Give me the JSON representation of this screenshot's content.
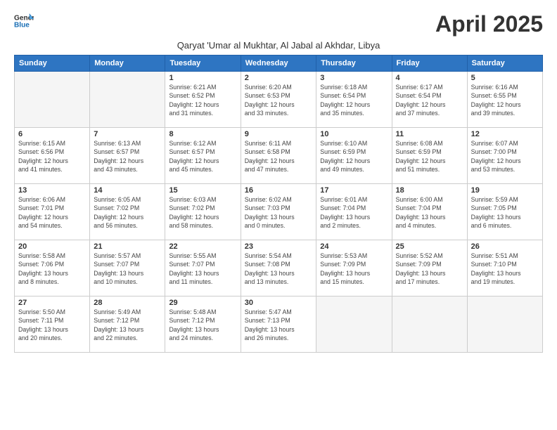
{
  "logo": {
    "line1": "General",
    "line2": "Blue"
  },
  "title": "April 2025",
  "subtitle": "Qaryat 'Umar al Mukhtar, Al Jabal al Akhdar, Libya",
  "days_of_week": [
    "Sunday",
    "Monday",
    "Tuesday",
    "Wednesday",
    "Thursday",
    "Friday",
    "Saturday"
  ],
  "weeks": [
    [
      {
        "num": "",
        "info": ""
      },
      {
        "num": "",
        "info": ""
      },
      {
        "num": "1",
        "info": "Sunrise: 6:21 AM\nSunset: 6:52 PM\nDaylight: 12 hours\nand 31 minutes."
      },
      {
        "num": "2",
        "info": "Sunrise: 6:20 AM\nSunset: 6:53 PM\nDaylight: 12 hours\nand 33 minutes."
      },
      {
        "num": "3",
        "info": "Sunrise: 6:18 AM\nSunset: 6:54 PM\nDaylight: 12 hours\nand 35 minutes."
      },
      {
        "num": "4",
        "info": "Sunrise: 6:17 AM\nSunset: 6:54 PM\nDaylight: 12 hours\nand 37 minutes."
      },
      {
        "num": "5",
        "info": "Sunrise: 6:16 AM\nSunset: 6:55 PM\nDaylight: 12 hours\nand 39 minutes."
      }
    ],
    [
      {
        "num": "6",
        "info": "Sunrise: 6:15 AM\nSunset: 6:56 PM\nDaylight: 12 hours\nand 41 minutes."
      },
      {
        "num": "7",
        "info": "Sunrise: 6:13 AM\nSunset: 6:57 PM\nDaylight: 12 hours\nand 43 minutes."
      },
      {
        "num": "8",
        "info": "Sunrise: 6:12 AM\nSunset: 6:57 PM\nDaylight: 12 hours\nand 45 minutes."
      },
      {
        "num": "9",
        "info": "Sunrise: 6:11 AM\nSunset: 6:58 PM\nDaylight: 12 hours\nand 47 minutes."
      },
      {
        "num": "10",
        "info": "Sunrise: 6:10 AM\nSunset: 6:59 PM\nDaylight: 12 hours\nand 49 minutes."
      },
      {
        "num": "11",
        "info": "Sunrise: 6:08 AM\nSunset: 6:59 PM\nDaylight: 12 hours\nand 51 minutes."
      },
      {
        "num": "12",
        "info": "Sunrise: 6:07 AM\nSunset: 7:00 PM\nDaylight: 12 hours\nand 53 minutes."
      }
    ],
    [
      {
        "num": "13",
        "info": "Sunrise: 6:06 AM\nSunset: 7:01 PM\nDaylight: 12 hours\nand 54 minutes."
      },
      {
        "num": "14",
        "info": "Sunrise: 6:05 AM\nSunset: 7:02 PM\nDaylight: 12 hours\nand 56 minutes."
      },
      {
        "num": "15",
        "info": "Sunrise: 6:03 AM\nSunset: 7:02 PM\nDaylight: 12 hours\nand 58 minutes."
      },
      {
        "num": "16",
        "info": "Sunrise: 6:02 AM\nSunset: 7:03 PM\nDaylight: 13 hours\nand 0 minutes."
      },
      {
        "num": "17",
        "info": "Sunrise: 6:01 AM\nSunset: 7:04 PM\nDaylight: 13 hours\nand 2 minutes."
      },
      {
        "num": "18",
        "info": "Sunrise: 6:00 AM\nSunset: 7:04 PM\nDaylight: 13 hours\nand 4 minutes."
      },
      {
        "num": "19",
        "info": "Sunrise: 5:59 AM\nSunset: 7:05 PM\nDaylight: 13 hours\nand 6 minutes."
      }
    ],
    [
      {
        "num": "20",
        "info": "Sunrise: 5:58 AM\nSunset: 7:06 PM\nDaylight: 13 hours\nand 8 minutes."
      },
      {
        "num": "21",
        "info": "Sunrise: 5:57 AM\nSunset: 7:07 PM\nDaylight: 13 hours\nand 10 minutes."
      },
      {
        "num": "22",
        "info": "Sunrise: 5:55 AM\nSunset: 7:07 PM\nDaylight: 13 hours\nand 11 minutes."
      },
      {
        "num": "23",
        "info": "Sunrise: 5:54 AM\nSunset: 7:08 PM\nDaylight: 13 hours\nand 13 minutes."
      },
      {
        "num": "24",
        "info": "Sunrise: 5:53 AM\nSunset: 7:09 PM\nDaylight: 13 hours\nand 15 minutes."
      },
      {
        "num": "25",
        "info": "Sunrise: 5:52 AM\nSunset: 7:09 PM\nDaylight: 13 hours\nand 17 minutes."
      },
      {
        "num": "26",
        "info": "Sunrise: 5:51 AM\nSunset: 7:10 PM\nDaylight: 13 hours\nand 19 minutes."
      }
    ],
    [
      {
        "num": "27",
        "info": "Sunrise: 5:50 AM\nSunset: 7:11 PM\nDaylight: 13 hours\nand 20 minutes."
      },
      {
        "num": "28",
        "info": "Sunrise: 5:49 AM\nSunset: 7:12 PM\nDaylight: 13 hours\nand 22 minutes."
      },
      {
        "num": "29",
        "info": "Sunrise: 5:48 AM\nSunset: 7:12 PM\nDaylight: 13 hours\nand 24 minutes."
      },
      {
        "num": "30",
        "info": "Sunrise: 5:47 AM\nSunset: 7:13 PM\nDaylight: 13 hours\nand 26 minutes."
      },
      {
        "num": "",
        "info": ""
      },
      {
        "num": "",
        "info": ""
      },
      {
        "num": "",
        "info": ""
      }
    ]
  ]
}
